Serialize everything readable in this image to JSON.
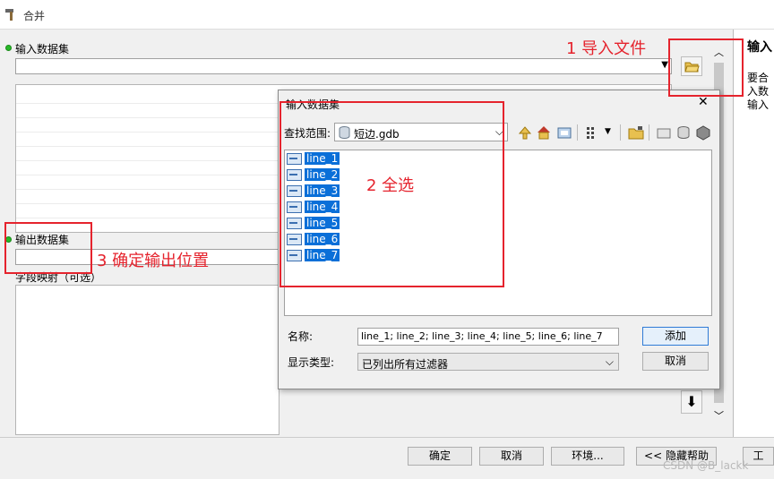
{
  "window": {
    "title": "合并"
  },
  "main": {
    "input_label": "输入数据集",
    "output_label": "输出数据集",
    "field_map_label": "字段映射（可选）"
  },
  "right_panel": {
    "heading": "输入",
    "text1": "要合",
    "text2": "入数",
    "text3": "输入"
  },
  "bottom": {
    "ok": "确定",
    "cancel": "取消",
    "env": "环境...",
    "hide_help": "<< 隐藏帮助",
    "tool": "工",
    "watermark": "CSDN @B_lackk"
  },
  "dialog": {
    "title": "输入数据集",
    "lookin_label": "查找范围:",
    "lookin_value": "短边.gdb",
    "items": [
      "line_1",
      "line_2",
      "line_3",
      "line_4",
      "line_5",
      "line_6",
      "line_7"
    ],
    "name_label": "名称:",
    "name_value": "line_1; line_2; line_3; line_4; line_5; line_6; line_7",
    "type_label": "显示类型:",
    "type_value": "已列出所有过滤器",
    "add": "添加",
    "cancel": "取消",
    "close": "✕"
  },
  "annotations": {
    "a1": "1 导入文件",
    "a2": "2 全选",
    "a3": "3 确定输出位置"
  },
  "colors": {
    "annotation": "#e5232d",
    "selection": "#0a6fd8"
  }
}
